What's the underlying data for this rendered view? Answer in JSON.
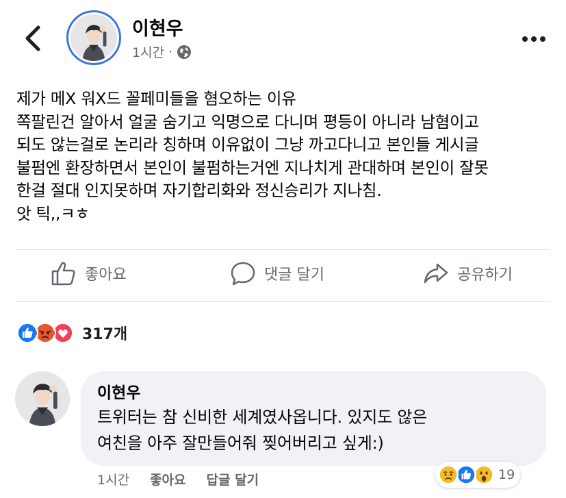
{
  "post": {
    "author": "이현우",
    "time": "1시간",
    "separator": "·",
    "audience_icon": "globe-icon",
    "text": "제가 메X 워X드 꼴페미들을 혐오하는 이유\n쪽팔린건 알아서 얼굴 숨기고 익명으로 다니며 평등이 아니라 남혐이고\n되도 않는걸로 논리라 칭하며 이유없이 그냥 까고다니고 본인들 게시글\n불펌엔 환장하면서 본인이 불펌하는거엔 지나치게 관대하며 본인이 잘못\n한걸 절대 인지못하며 자기합리화와 정신승리가 지나침.\n앗 틱,,ㅋㅎ"
  },
  "actions": {
    "like": "좋아요",
    "comment": "댓글 달기",
    "share": "공유하기"
  },
  "reactions": {
    "types": [
      "like",
      "angry",
      "love"
    ],
    "count": "317개"
  },
  "comment": {
    "author": "이현우",
    "text": "트위터는 참 신비한 세계였사옵니다. 있지도 않은\n여친을 아주 잘만들어줘 찢어버리고 싶게:)",
    "time": "1시간",
    "like": "좋아요",
    "reply": "답글 달기",
    "reactions": [
      "sad",
      "like",
      "wow"
    ],
    "reaction_count": "19"
  },
  "colors": {
    "accent": "#3b73e6",
    "like_blue": "#1877f2",
    "angry": "#e4582b",
    "love": "#f33e58",
    "wow_yellow": "#f7b928"
  }
}
